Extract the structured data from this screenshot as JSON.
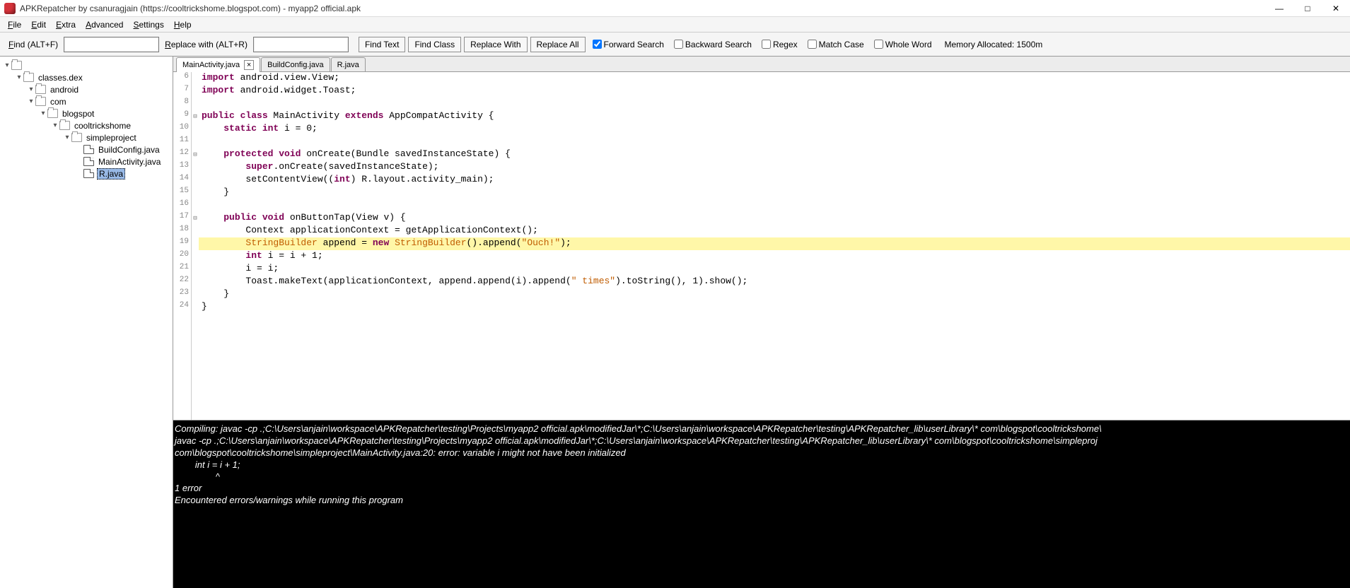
{
  "title": "APKRepatcher by csanuragjain (https://cooltrickshome.blogspot.com) - myapp2 official.apk",
  "window_controls": {
    "min": "—",
    "max": "□",
    "close": "✕"
  },
  "menu": [
    "File",
    "Edit",
    "Extra",
    "Advanced",
    "Settings",
    "Help"
  ],
  "toolbar": {
    "find_label": "Find (ALT+F)",
    "replace_label": "Replace with (ALT+R)",
    "find_value": "",
    "replace_value": "",
    "btn_find_text": "Find Text",
    "btn_find_class": "Find Class",
    "btn_replace_with": "Replace With",
    "btn_replace_all": "Replace All",
    "chk_forward": "Forward Search",
    "chk_forward_checked": true,
    "chk_backward": "Backward Search",
    "chk_backward_checked": false,
    "chk_regex": "Regex",
    "chk_regex_checked": false,
    "chk_matchcase": "Match Case",
    "chk_matchcase_checked": false,
    "chk_wholeword": "Whole Word",
    "chk_wholeword_checked": false,
    "memory": "Memory Allocated: 1500m"
  },
  "tree": [
    {
      "indent": 0,
      "toggle": "▾",
      "icon": "folder",
      "label": "",
      "selected": false
    },
    {
      "indent": 1,
      "toggle": "▾",
      "icon": "folder",
      "label": "classes.dex",
      "selected": false
    },
    {
      "indent": 2,
      "toggle": "▾",
      "icon": "folder",
      "label": "android",
      "selected": false
    },
    {
      "indent": 2,
      "toggle": "▾",
      "icon": "folder",
      "label": "com",
      "selected": false
    },
    {
      "indent": 3,
      "toggle": "▾",
      "icon": "folder",
      "label": "blogspot",
      "selected": false
    },
    {
      "indent": 4,
      "toggle": "▾",
      "icon": "folder",
      "label": "cooltrickshome",
      "selected": false
    },
    {
      "indent": 5,
      "toggle": "▾",
      "icon": "folder",
      "label": "simpleproject",
      "selected": false
    },
    {
      "indent": 6,
      "toggle": " ",
      "icon": "file",
      "label": "BuildConfig.java",
      "selected": false
    },
    {
      "indent": 6,
      "toggle": " ",
      "icon": "file",
      "label": "MainActivity.java",
      "selected": false
    },
    {
      "indent": 6,
      "toggle": " ",
      "icon": "file",
      "label": "R.java",
      "selected": true
    }
  ],
  "tabs": [
    {
      "label": "MainActivity.java",
      "active": true,
      "closeable": true
    },
    {
      "label": "BuildConfig.java",
      "active": false,
      "closeable": false
    },
    {
      "label": "R.java",
      "active": false,
      "closeable": false
    }
  ],
  "code": {
    "first_line": 6,
    "lines": [
      {
        "n": 6,
        "fold": "",
        "hl": false,
        "tokens": [
          [
            "kw",
            "import"
          ],
          [
            "plain",
            " android.view.View;"
          ]
        ]
      },
      {
        "n": 7,
        "fold": "",
        "hl": false,
        "tokens": [
          [
            "kw",
            "import"
          ],
          [
            "plain",
            " android.widget.Toast;"
          ]
        ]
      },
      {
        "n": 8,
        "fold": "",
        "hl": false,
        "tokens": [
          [
            "plain",
            ""
          ]
        ]
      },
      {
        "n": 9,
        "fold": "⊟",
        "hl": false,
        "tokens": [
          [
            "kw",
            "public class"
          ],
          [
            "plain",
            " MainActivity "
          ],
          [
            "kw",
            "extends"
          ],
          [
            "plain",
            " AppCompatActivity {"
          ]
        ]
      },
      {
        "n": 10,
        "fold": "",
        "hl": false,
        "tokens": [
          [
            "plain",
            "    "
          ],
          [
            "kw",
            "static int"
          ],
          [
            "plain",
            " i = 0;"
          ]
        ]
      },
      {
        "n": 11,
        "fold": "",
        "hl": false,
        "tokens": [
          [
            "plain",
            ""
          ]
        ]
      },
      {
        "n": 12,
        "fold": "⊟",
        "hl": false,
        "tokens": [
          [
            "plain",
            "    "
          ],
          [
            "kw",
            "protected void"
          ],
          [
            "plain",
            " onCreate(Bundle savedInstanceState) {"
          ]
        ]
      },
      {
        "n": 13,
        "fold": "",
        "hl": false,
        "tokens": [
          [
            "plain",
            "        "
          ],
          [
            "kw",
            "super"
          ],
          [
            "plain",
            ".onCreate(savedInstanceState);"
          ]
        ]
      },
      {
        "n": 14,
        "fold": "",
        "hl": false,
        "tokens": [
          [
            "plain",
            "        setContentView(("
          ],
          [
            "kw",
            "int"
          ],
          [
            "plain",
            ") R.layout.activity_main);"
          ]
        ]
      },
      {
        "n": 15,
        "fold": "",
        "hl": false,
        "tokens": [
          [
            "plain",
            "    }"
          ]
        ]
      },
      {
        "n": 16,
        "fold": "",
        "hl": false,
        "tokens": [
          [
            "plain",
            ""
          ]
        ]
      },
      {
        "n": 17,
        "fold": "⊟",
        "hl": false,
        "tokens": [
          [
            "plain",
            "    "
          ],
          [
            "kw",
            "public void"
          ],
          [
            "plain",
            " onButtonTap(View v) {"
          ]
        ]
      },
      {
        "n": 18,
        "fold": "",
        "hl": false,
        "tokens": [
          [
            "plain",
            "        Context applicationContext = getApplicationContext();"
          ]
        ]
      },
      {
        "n": 19,
        "fold": "",
        "hl": true,
        "tokens": [
          [
            "plain",
            "        "
          ],
          [
            "typ",
            "StringBuilder"
          ],
          [
            "plain",
            " append = "
          ],
          [
            "kw",
            "new"
          ],
          [
            "plain",
            " "
          ],
          [
            "typ",
            "StringBuilder"
          ],
          [
            "plain",
            "().append("
          ],
          [
            "str",
            "\"Ouch!\""
          ],
          [
            "plain",
            ");"
          ]
        ]
      },
      {
        "n": 20,
        "fold": "",
        "hl": false,
        "tokens": [
          [
            "plain",
            "        "
          ],
          [
            "kw",
            "int"
          ],
          [
            "plain",
            " i = i + 1;"
          ]
        ]
      },
      {
        "n": 21,
        "fold": "",
        "hl": false,
        "tokens": [
          [
            "plain",
            "        i = i;"
          ]
        ]
      },
      {
        "n": 22,
        "fold": "",
        "hl": false,
        "tokens": [
          [
            "plain",
            "        Toast.makeText(applicationContext, append.append(i).append("
          ],
          [
            "str",
            "\" times\""
          ],
          [
            "plain",
            ").toString(), 1).show();"
          ]
        ]
      },
      {
        "n": 23,
        "fold": "",
        "hl": false,
        "tokens": [
          [
            "plain",
            "    }"
          ]
        ]
      },
      {
        "n": 24,
        "fold": "",
        "hl": false,
        "tokens": [
          [
            "plain",
            "}"
          ]
        ]
      }
    ]
  },
  "console": [
    "Compiling: javac -cp .;C:\\Users\\anjain\\workspace\\APKRepatcher\\testing\\Projects\\myapp2 official.apk\\modifiedJar\\*;C:\\Users\\anjain\\workspace\\APKRepatcher\\testing\\APKRepatcher_lib\\userLibrary\\* com\\blogspot\\cooltrickshome\\",
    "javac -cp .;C:\\Users\\anjain\\workspace\\APKRepatcher\\testing\\Projects\\myapp2 official.apk\\modifiedJar\\*;C:\\Users\\anjain\\workspace\\APKRepatcher\\testing\\APKRepatcher_lib\\userLibrary\\* com\\blogspot\\cooltrickshome\\simpleproj",
    "com\\blogspot\\cooltrickshome\\simpleproject\\MainActivity.java:20: error: variable i might not have been initialized",
    "        int i = i + 1;",
    "                ^",
    "1 error",
    "Encountered errors/warnings while running this program"
  ]
}
